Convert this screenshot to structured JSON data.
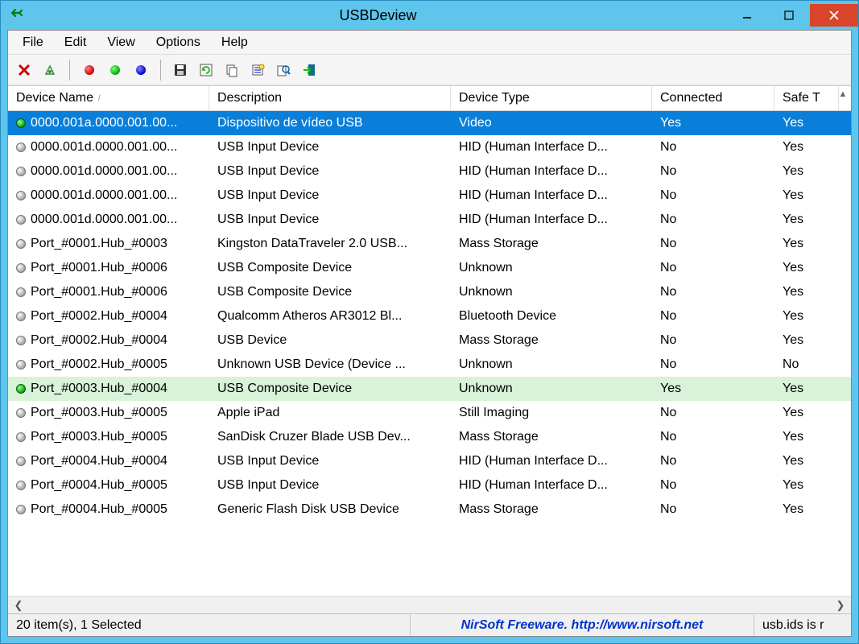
{
  "window": {
    "title": "USBDeview"
  },
  "menu": {
    "items": [
      "File",
      "Edit",
      "View",
      "Options",
      "Help"
    ]
  },
  "columns": [
    "Device Name",
    "Description",
    "Device Type",
    "Connected",
    "Safe T"
  ],
  "rows": [
    {
      "dot": "grn",
      "selected": true,
      "green": false,
      "name": "0000.001a.0000.001.00...",
      "desc": "Dispositivo de vídeo USB",
      "type": "Video",
      "conn": "Yes",
      "safe": "Yes"
    },
    {
      "dot": "gray",
      "selected": false,
      "green": false,
      "name": "0000.001d.0000.001.00...",
      "desc": "USB Input Device",
      "type": "HID (Human Interface D...",
      "conn": "No",
      "safe": "Yes"
    },
    {
      "dot": "gray",
      "selected": false,
      "green": false,
      "name": "0000.001d.0000.001.00...",
      "desc": "USB Input Device",
      "type": "HID (Human Interface D...",
      "conn": "No",
      "safe": "Yes"
    },
    {
      "dot": "gray",
      "selected": false,
      "green": false,
      "name": "0000.001d.0000.001.00...",
      "desc": "USB Input Device",
      "type": "HID (Human Interface D...",
      "conn": "No",
      "safe": "Yes"
    },
    {
      "dot": "gray",
      "selected": false,
      "green": false,
      "name": "0000.001d.0000.001.00...",
      "desc": "USB Input Device",
      "type": "HID (Human Interface D...",
      "conn": "No",
      "safe": "Yes"
    },
    {
      "dot": "gray",
      "selected": false,
      "green": false,
      "name": "Port_#0001.Hub_#0003",
      "desc": "Kingston DataTraveler 2.0 USB...",
      "type": "Mass Storage",
      "conn": "No",
      "safe": "Yes"
    },
    {
      "dot": "gray",
      "selected": false,
      "green": false,
      "name": "Port_#0001.Hub_#0006",
      "desc": "USB Composite Device",
      "type": "Unknown",
      "conn": "No",
      "safe": "Yes"
    },
    {
      "dot": "gray",
      "selected": false,
      "green": false,
      "name": "Port_#0001.Hub_#0006",
      "desc": "USB Composite Device",
      "type": "Unknown",
      "conn": "No",
      "safe": "Yes"
    },
    {
      "dot": "gray",
      "selected": false,
      "green": false,
      "name": "Port_#0002.Hub_#0004",
      "desc": "Qualcomm Atheros AR3012 Bl...",
      "type": "Bluetooth Device",
      "conn": "No",
      "safe": "Yes"
    },
    {
      "dot": "gray",
      "selected": false,
      "green": false,
      "name": "Port_#0002.Hub_#0004",
      "desc": "USB Device",
      "type": "Mass Storage",
      "conn": "No",
      "safe": "Yes"
    },
    {
      "dot": "gray",
      "selected": false,
      "green": false,
      "name": "Port_#0002.Hub_#0005",
      "desc": "Unknown USB Device (Device ...",
      "type": "Unknown",
      "conn": "No",
      "safe": "No"
    },
    {
      "dot": "grn",
      "selected": false,
      "green": true,
      "name": "Port_#0003.Hub_#0004",
      "desc": "USB Composite Device",
      "type": "Unknown",
      "conn": "Yes",
      "safe": "Yes"
    },
    {
      "dot": "gray",
      "selected": false,
      "green": false,
      "name": "Port_#0003.Hub_#0005",
      "desc": "Apple iPad",
      "type": "Still Imaging",
      "conn": "No",
      "safe": "Yes"
    },
    {
      "dot": "gray",
      "selected": false,
      "green": false,
      "name": "Port_#0003.Hub_#0005",
      "desc": "SanDisk Cruzer Blade USB Dev...",
      "type": "Mass Storage",
      "conn": "No",
      "safe": "Yes"
    },
    {
      "dot": "gray",
      "selected": false,
      "green": false,
      "name": "Port_#0004.Hub_#0004",
      "desc": "USB Input Device",
      "type": "HID (Human Interface D...",
      "conn": "No",
      "safe": "Yes"
    },
    {
      "dot": "gray",
      "selected": false,
      "green": false,
      "name": "Port_#0004.Hub_#0005",
      "desc": "USB Input Device",
      "type": "HID (Human Interface D...",
      "conn": "No",
      "safe": "Yes"
    },
    {
      "dot": "gray",
      "selected": false,
      "green": false,
      "name": "Port_#0004.Hub_#0005",
      "desc": "Generic Flash Disk USB Device",
      "type": "Mass Storage",
      "conn": "No",
      "safe": "Yes"
    }
  ],
  "status": {
    "left": "20 item(s), 1 Selected",
    "center": "NirSoft Freeware.  http://www.nirsoft.net",
    "right": "usb.ids is r"
  }
}
